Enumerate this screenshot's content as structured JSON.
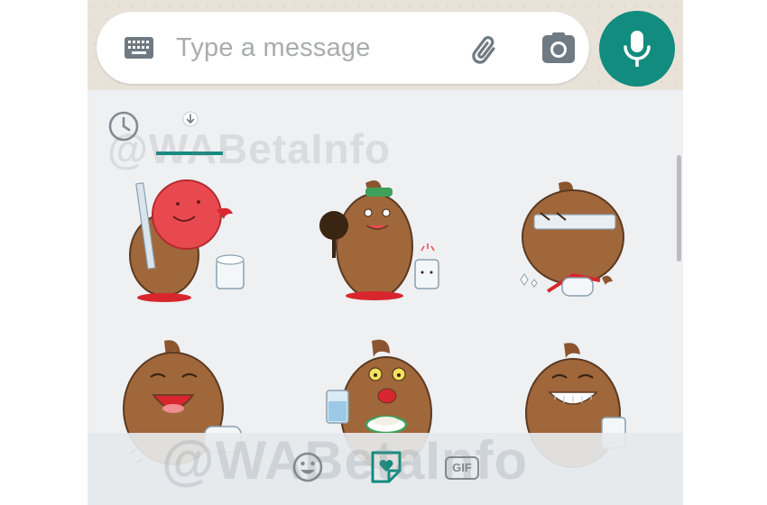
{
  "composer": {
    "placeholder": "Type a message",
    "icons": [
      "keyboard-icon",
      "attach-icon",
      "camera-icon",
      "mic-icon"
    ]
  },
  "sticker_tabs": {
    "items": [
      "recent-icon",
      "sticker-pack-download-icon"
    ],
    "active": 1
  },
  "watermark": "@WABetaInfo",
  "stickers": [
    {
      "row": 1,
      "col": 1,
      "name": "poop-with-red-balloon"
    },
    {
      "row": 1,
      "col": 2,
      "name": "poop-with-mirror"
    },
    {
      "row": 1,
      "col": 3,
      "name": "poop-crying-toilet-paper"
    },
    {
      "row": 2,
      "col": 1,
      "name": "poop-laughing"
    },
    {
      "row": 2,
      "col": 2,
      "name": "poop-eating"
    },
    {
      "row": 2,
      "col": 3,
      "name": "poop-smiling"
    }
  ],
  "bottom_tabs": {
    "emoji": "emoji-icon",
    "sticker": "sticker-icon",
    "gif_label": "GIF",
    "active": "sticker"
  },
  "colors": {
    "accent": "#128c7e",
    "poop": "#a0673b",
    "panel_bg": "#eef0f2",
    "icon_gray": "#838b92"
  }
}
